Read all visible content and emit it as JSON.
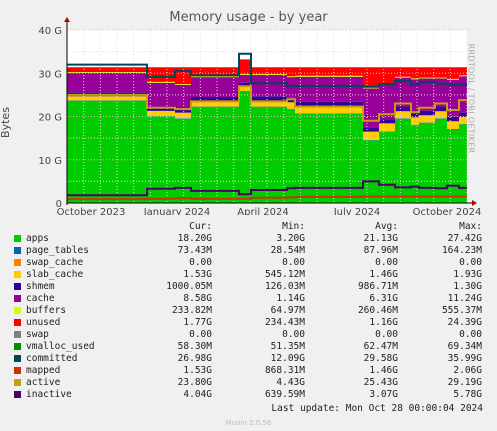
{
  "chart_data": {
    "type": "area",
    "title": "Memory usage - by year",
    "ylabel": "Bytes",
    "side_label": "RRDTOOL / TOBI OETIKER",
    "y_ticks": [
      "0",
      "10 G",
      "20 G",
      "30 G",
      "40 G"
    ],
    "ylim": [
      0,
      40
    ],
    "x_ticks": [
      "October 2023",
      "January 2024",
      "April 2024",
      "July 2024",
      "October 2024"
    ],
    "x_tick_pos": [
      0.06,
      0.275,
      0.49,
      0.725,
      0.95
    ],
    "grid": true,
    "stack_breaks": [
      0,
      0.2,
      0.27,
      0.31,
      0.43,
      0.46,
      0.55,
      0.57,
      0.74,
      0.78,
      0.82,
      0.86,
      0.88,
      0.92,
      0.95,
      0.98,
      1
    ],
    "stacks": [
      {
        "name": "apps",
        "color": "#00cc00",
        "values": [
          23.6,
          20.0,
          19.5,
          22.2,
          25.8,
          22.2,
          21.7,
          20.6,
          14.5,
          16.5,
          19.5,
          18.0,
          18.5,
          19.5,
          17.0,
          18.2
        ]
      },
      {
        "name": "page_tables",
        "color": "#0066b3",
        "values": [
          0.1,
          0.1,
          0.1,
          0.1,
          0.1,
          0.1,
          0.1,
          0.1,
          0.1,
          0.1,
          0.1,
          0.1,
          0.1,
          0.1,
          0.1,
          0.1
        ]
      },
      {
        "name": "slab_cache",
        "color": "#ffcc00",
        "values": [
          1.0,
          1.2,
          1.3,
          1.3,
          1.0,
          1.4,
          1.5,
          1.7,
          1.9,
          1.8,
          1.6,
          1.7,
          1.7,
          1.6,
          1.8,
          1.6
        ]
      },
      {
        "name": "shmem",
        "color": "#330099",
        "values": [
          0.9,
          0.9,
          0.9,
          0.9,
          0.9,
          1.0,
          1.0,
          1.0,
          1.0,
          1.0,
          1.0,
          1.0,
          1.0,
          1.0,
          1.0,
          1.0
        ]
      },
      {
        "name": "cache",
        "color": "#990099",
        "values": [
          4.5,
          5.6,
          5.5,
          4.6,
          1.8,
          4.9,
          4.8,
          5.8,
          9.0,
          8.0,
          6.8,
          7.8,
          7.5,
          6.6,
          8.6,
          8.4
        ]
      },
      {
        "name": "buffers",
        "color": "#ccff00",
        "values": [
          0.2,
          0.2,
          0.2,
          0.2,
          0.2,
          0.2,
          0.2,
          0.2,
          0.2,
          0.2,
          0.2,
          0.2,
          0.2,
          0.2,
          0.2,
          0.2
        ]
      },
      {
        "name": "unused",
        "color": "#ff0000",
        "values": [
          1.1,
          3.4,
          3.9,
          2.1,
          3.4,
          1.6,
          2.1,
          2.0,
          4.7,
          3.8,
          2.2,
          2.6,
          2.4,
          2.4,
          2.7,
          1.9
        ]
      }
    ],
    "lines": [
      {
        "name": "committed",
        "color": "#00455a",
        "values": [
          32.0,
          29.2,
          30.5,
          29.5,
          34.5,
          27.7,
          27.0,
          27.0,
          26.9,
          27.5,
          28.2,
          27.4,
          28.0,
          27.6,
          27.3,
          27.4
        ]
      },
      {
        "name": "active",
        "color": "#c2a010",
        "values": [
          25.0,
          22.0,
          21.7,
          23.5,
          27.0,
          23.5,
          24.0,
          22.3,
          19.0,
          20.5,
          23.0,
          21.0,
          22.0,
          23.0,
          21.5,
          23.8
        ]
      },
      {
        "name": "inactive",
        "color": "#4d0066",
        "values": [
          1.8,
          3.3,
          3.5,
          2.8,
          2.0,
          3.0,
          3.4,
          3.5,
          5.0,
          4.2,
          3.6,
          3.8,
          3.5,
          3.4,
          4.0,
          3.5
        ]
      },
      {
        "name": "mapped",
        "color": "#cc3300",
        "values": [
          0.9,
          1.0,
          1.1,
          1.0,
          1.0,
          1.2,
          1.3,
          1.4,
          1.5,
          1.5,
          1.5,
          1.5,
          1.5,
          1.5,
          1.5,
          1.5
        ]
      }
    ],
    "legend_columns": [
      "Cur:",
      "Min:",
      "Avg:",
      "Max:"
    ],
    "legend": [
      {
        "name": "apps",
        "color": "#00cc00",
        "cur": "18.20G",
        "min": "3.20G",
        "avg": "21.13G",
        "max": "27.42G"
      },
      {
        "name": "page_tables",
        "color": "#0066b3",
        "cur": "73.43M",
        "min": "28.54M",
        "avg": "87.96M",
        "max": "164.23M"
      },
      {
        "name": "swap_cache",
        "color": "#ff8000",
        "cur": "0.00",
        "min": "0.00",
        "avg": "0.00",
        "max": "0.00"
      },
      {
        "name": "slab_cache",
        "color": "#ffcc00",
        "cur": "1.53G",
        "min": "545.12M",
        "avg": "1.46G",
        "max": "1.93G"
      },
      {
        "name": "shmem",
        "color": "#330099",
        "cur": "1000.05M",
        "min": "126.03M",
        "avg": "986.71M",
        "max": "1.30G"
      },
      {
        "name": "cache",
        "color": "#990099",
        "cur": "8.58G",
        "min": "1.14G",
        "avg": "6.31G",
        "max": "11.24G"
      },
      {
        "name": "buffers",
        "color": "#ccff00",
        "cur": "233.82M",
        "min": "64.97M",
        "avg": "260.46M",
        "max": "555.37M"
      },
      {
        "name": "unused",
        "color": "#ff0000",
        "cur": "1.77G",
        "min": "234.43M",
        "avg": "1.16G",
        "max": "24.39G"
      },
      {
        "name": "swap",
        "color": "#808080",
        "cur": "0.00",
        "min": "0.00",
        "avg": "0.00",
        "max": "0.00"
      },
      {
        "name": "vmalloc_used",
        "color": "#008f00",
        "cur": "58.30M",
        "min": "51.35M",
        "avg": "62.47M",
        "max": "69.34M"
      },
      {
        "name": "committed",
        "color": "#00455a",
        "cur": "26.98G",
        "min": "12.09G",
        "avg": "29.58G",
        "max": "35.99G"
      },
      {
        "name": "mapped",
        "color": "#cc3300",
        "cur": "1.53G",
        "min": "868.31M",
        "avg": "1.46G",
        "max": "2.06G"
      },
      {
        "name": "active",
        "color": "#c2a010",
        "cur": "23.80G",
        "min": "4.43G",
        "avg": "25.43G",
        "max": "29.19G"
      },
      {
        "name": "inactive",
        "color": "#4d0066",
        "cur": "4.04G",
        "min": "639.59M",
        "avg": "3.07G",
        "max": "5.78G"
      }
    ]
  },
  "footer": {
    "last_update": "Last update: Mon Oct 28 00:00:04 2024",
    "munin": "Munin 2.0.56"
  }
}
